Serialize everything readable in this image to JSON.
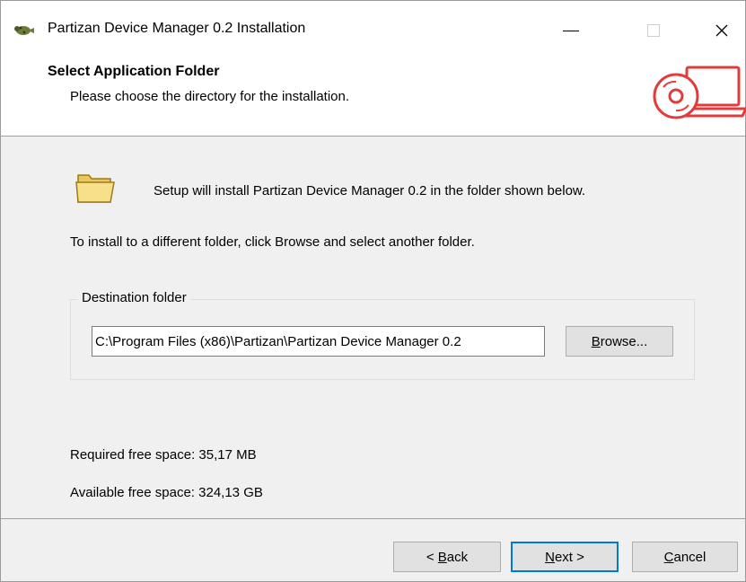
{
  "window": {
    "title": "Partizan Device Manager 0.2 Installation",
    "controls": {
      "minimize_icon": "minimize-icon",
      "maximize_icon": "maximize-icon",
      "close_glyph": "✕"
    }
  },
  "header": {
    "title": "Select Application Folder",
    "subtitle": "Please choose the directory for the installation."
  },
  "body": {
    "intro": "Setup will install Partizan Device Manager 0.2 in the folder shown below.",
    "instructions": "To install to a different folder, click Browse and select another folder."
  },
  "destination": {
    "group_label": "Destination folder",
    "path_value": "C:\\Program Files (x86)\\Partizan\\Partizan Device Manager 0.2",
    "browse_label_mnemonic": "B",
    "browse_label_rest": "rowse..."
  },
  "space": {
    "required": "Required free space: 35,17 MB",
    "available": "Available free space: 324,13 GB"
  },
  "footer": {
    "back_prefix": "< ",
    "back_mnemonic": "B",
    "back_rest": "ack",
    "next_mnemonic": "N",
    "next_rest": "ext >",
    "cancel_mnemonic": "C",
    "cancel_rest": "ancel"
  },
  "colors": {
    "accent": "#0078d7",
    "logo_red": "#e23b3b",
    "folder_yellow": "#f5d86b"
  }
}
